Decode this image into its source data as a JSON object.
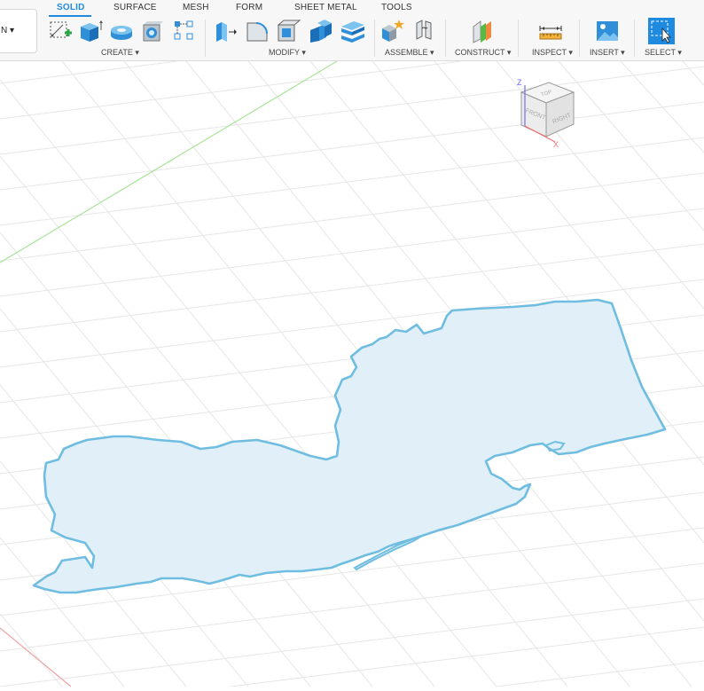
{
  "workspace": {
    "label": "N ▾"
  },
  "tabs": [
    {
      "label": "SOLID",
      "active": true
    },
    {
      "label": "SURFACE",
      "active": false
    },
    {
      "label": "MESH",
      "active": false
    },
    {
      "label": "FORM",
      "active": false
    },
    {
      "label": "SHEET METAL",
      "active": false
    },
    {
      "label": "TOOLS",
      "active": false
    }
  ],
  "groups": {
    "create": "CREATE ▾",
    "modify": "MODIFY ▾",
    "assemble": "ASSEMBLE ▾",
    "construct": "CONSTRUCT ▾",
    "inspect": "INSPECT ▾",
    "insert": "INSERT ▾",
    "select": "SELECT ▾"
  },
  "viewcube": {
    "top": "TOP",
    "front": "FRONT",
    "right": "RIGHT",
    "axis_z": "Z",
    "axis_x": "X"
  },
  "colors": {
    "accent": "#1f8be0",
    "sketch_stroke": "#6fbde0",
    "sketch_fill": "#dfeff8",
    "grid": "#e6e6e6",
    "y_axis": "#a9e49a",
    "x_axis": "#f0a0a0"
  }
}
